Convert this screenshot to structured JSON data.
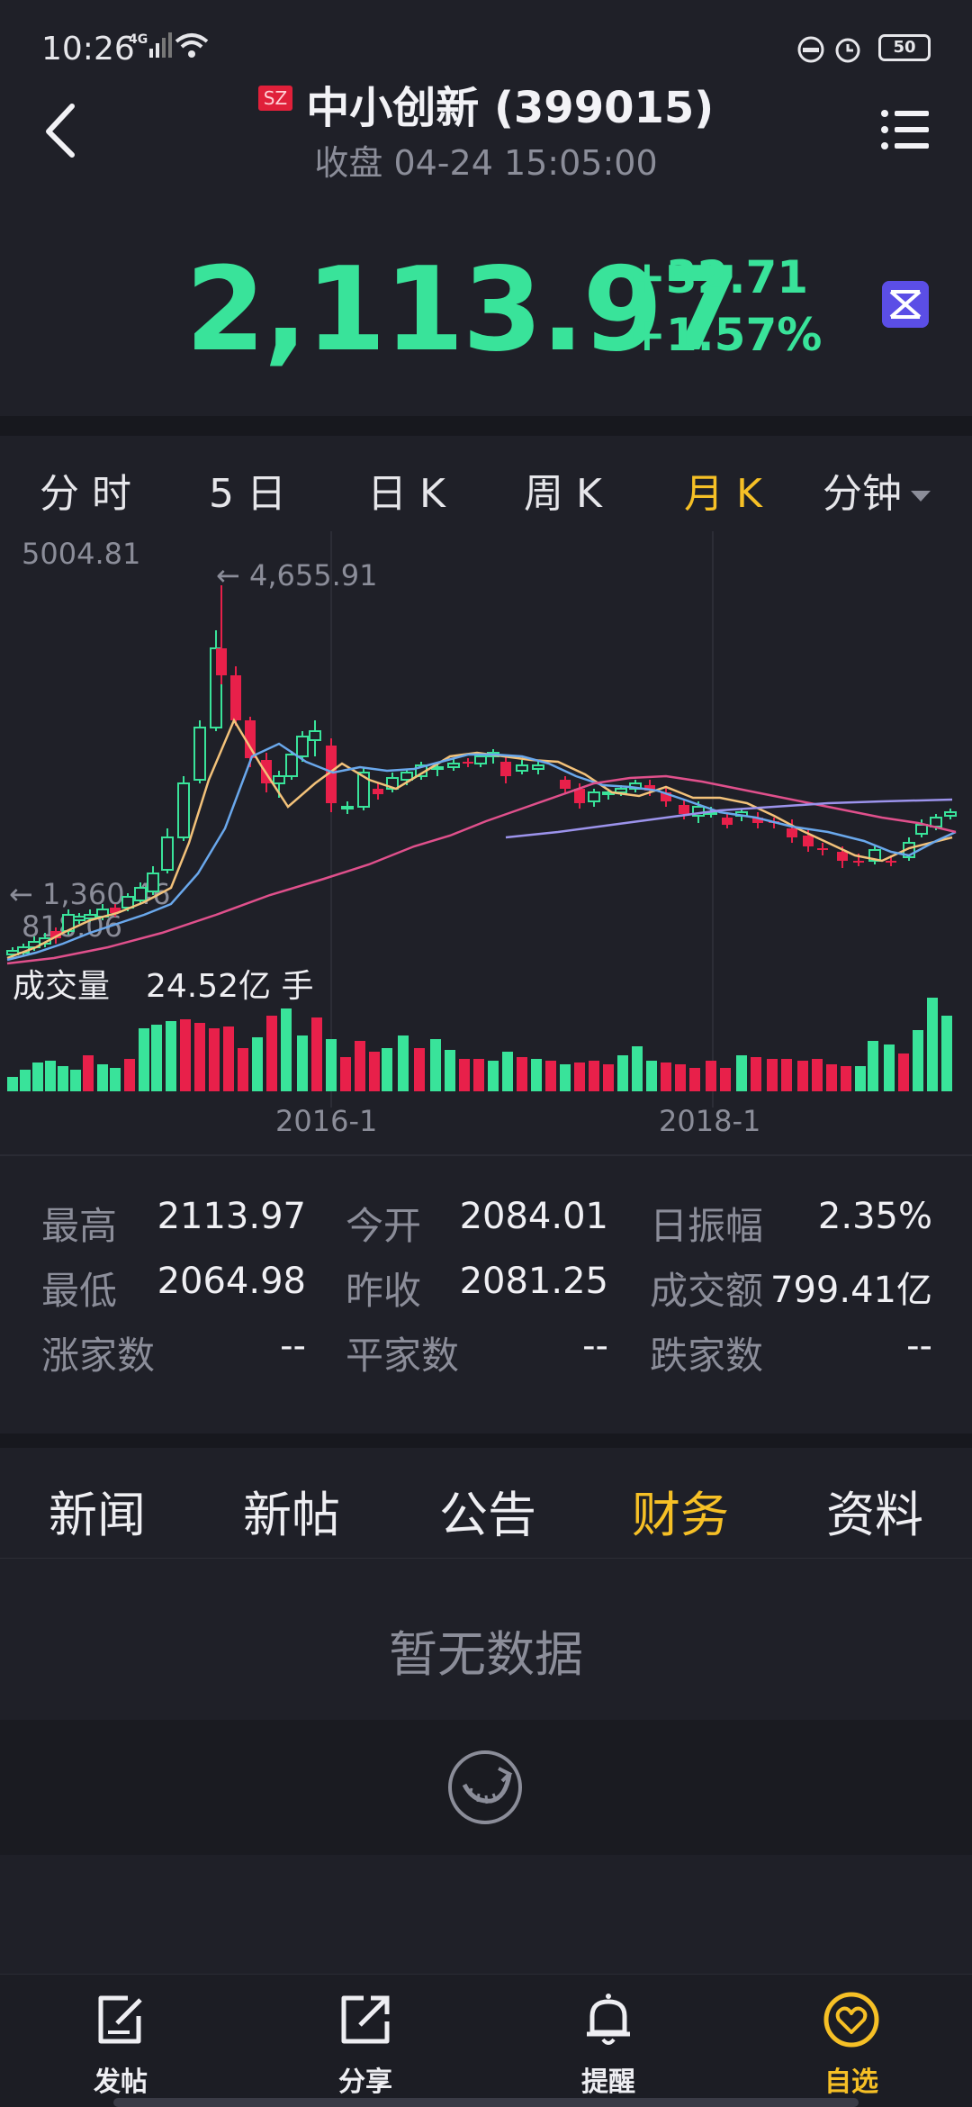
{
  "status_bar": {
    "time": "10:26",
    "network": "4G",
    "battery": "50"
  },
  "header": {
    "market_badge": "SZ",
    "title": "中小创新 (399015)",
    "subtitle": "收盘 04-24 15:05:00"
  },
  "quote": {
    "price": "2,113.97",
    "change": "+32.71",
    "change_pct": "+1.57%"
  },
  "chart_tabs": [
    {
      "label": "分 时",
      "active": false
    },
    {
      "label": "5 日",
      "active": false
    },
    {
      "label": "日 K",
      "active": false
    },
    {
      "label": "周 K",
      "active": false
    },
    {
      "label": "月 K",
      "active": true
    },
    {
      "label": "分钟",
      "active": false
    }
  ],
  "chart": {
    "y_top": "5004.81",
    "y_bottom": "818.06",
    "high_marker": "← 4,655.91",
    "low_marker": "← 1,360.46",
    "volume_label": "成交量",
    "volume_value": "24.52亿 手",
    "x_labels": [
      "2016-1",
      "2018-1"
    ]
  },
  "stats": [
    [
      {
        "label": "最高",
        "value": "2113.97"
      },
      {
        "label": "今开",
        "value": "2084.01"
      },
      {
        "label": "日振幅",
        "value": "2.35%"
      }
    ],
    [
      {
        "label": "最低",
        "value": "2064.98"
      },
      {
        "label": "昨收",
        "value": "2081.25"
      },
      {
        "label": "成交额",
        "value": "799.41亿"
      }
    ],
    [
      {
        "label": "涨家数",
        "value": "--"
      },
      {
        "label": "平家数",
        "value": "--"
      },
      {
        "label": "跌家数",
        "value": "--"
      }
    ]
  ],
  "news_tabs": [
    {
      "label": "新闻",
      "active": false
    },
    {
      "label": "新帖",
      "active": false
    },
    {
      "label": "公告",
      "active": false
    },
    {
      "label": "财务",
      "active": true
    },
    {
      "label": "资料",
      "active": false
    }
  ],
  "empty_state": "暂无数据",
  "bottom_nav": [
    {
      "label": "发帖",
      "icon": "compose-icon",
      "active": false
    },
    {
      "label": "分享",
      "icon": "share-icon",
      "active": false
    },
    {
      "label": "提醒",
      "icon": "bell-icon",
      "active": false
    },
    {
      "label": "自选",
      "icon": "heart-icon",
      "active": true
    }
  ],
  "colors": {
    "up": "#39e39a",
    "down": "#e8204a",
    "accent": "#f6c026",
    "background": "#1f2028"
  }
}
